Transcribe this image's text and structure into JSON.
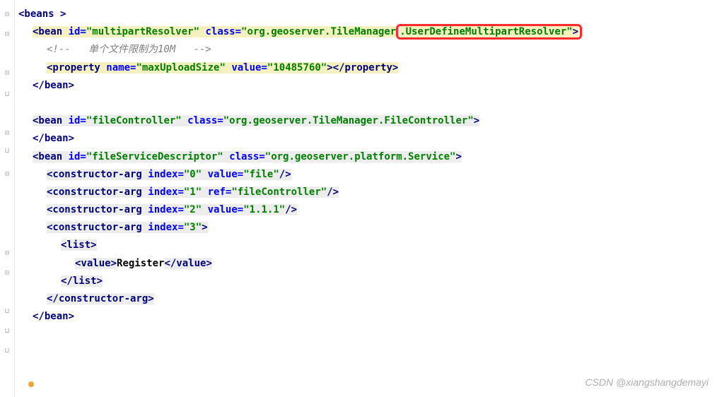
{
  "root": {
    "open": "<beans >",
    "close": "</beans>"
  },
  "bean1": {
    "open_a": "<bean ",
    "id_attr": "id=",
    "id_val": "\"multipartResolver\"",
    "class_attr": " class=",
    "class_val_a": "\"org.geoserver.TileManager",
    "class_val_b": ".UserDefineMultipartResolver\"",
    "open_b": ">",
    "comment": "<!--   单个文件限制为10M   -->",
    "prop_open": "<property ",
    "prop_name_attr": "name=",
    "prop_name_val": "\"maxUploadSize\"",
    "prop_value_attr": " value=",
    "prop_value_val": "\"10485760\"",
    "prop_mid": ">",
    "prop_close": "</property>",
    "close": "</bean>"
  },
  "bean2": {
    "open": "<bean ",
    "id_attr": "id=",
    "id_val": "\"fileController\"",
    "class_attr": " class=",
    "class_val": "\"org.geoserver.TileManager.FileController\"",
    "end": ">",
    "close": "</bean>"
  },
  "bean3": {
    "open": "<bean ",
    "id_attr": "id=",
    "id_val": "\"fileServiceDescriptor\"",
    "class_attr": " class=",
    "class_val": "\"org.geoserver.platform.Service\"",
    "end": ">",
    "close": "</bean>"
  },
  "ca0": {
    "open": "<constructor-arg ",
    "idx_attr": "index=",
    "idx_val": "\"0\"",
    "val_attr": " value=",
    "val_val": "\"file\"",
    "end": "/>"
  },
  "ca1": {
    "open": "<constructor-arg ",
    "idx_attr": "index=",
    "idx_val": "\"1\"",
    "ref_attr": " ref=",
    "ref_val": "\"fileController\"",
    "end": "/>"
  },
  "ca2": {
    "open": "<constructor-arg ",
    "idx_attr": "index=",
    "idx_val": "\"2\"",
    "val_attr": " value=",
    "val_val": "\"1.1.1\"",
    "end": "/>"
  },
  "ca3": {
    "open": "<constructor-arg ",
    "idx_attr": "index=",
    "idx_val": "\"3\"",
    "end": ">",
    "close": "</constructor-arg>"
  },
  "list": {
    "open": "<list>",
    "close": "</list>"
  },
  "value": {
    "open": "<value>",
    "text": "Register",
    "close": "</value>"
  },
  "watermark": "CSDN @xiangshangdemayi"
}
